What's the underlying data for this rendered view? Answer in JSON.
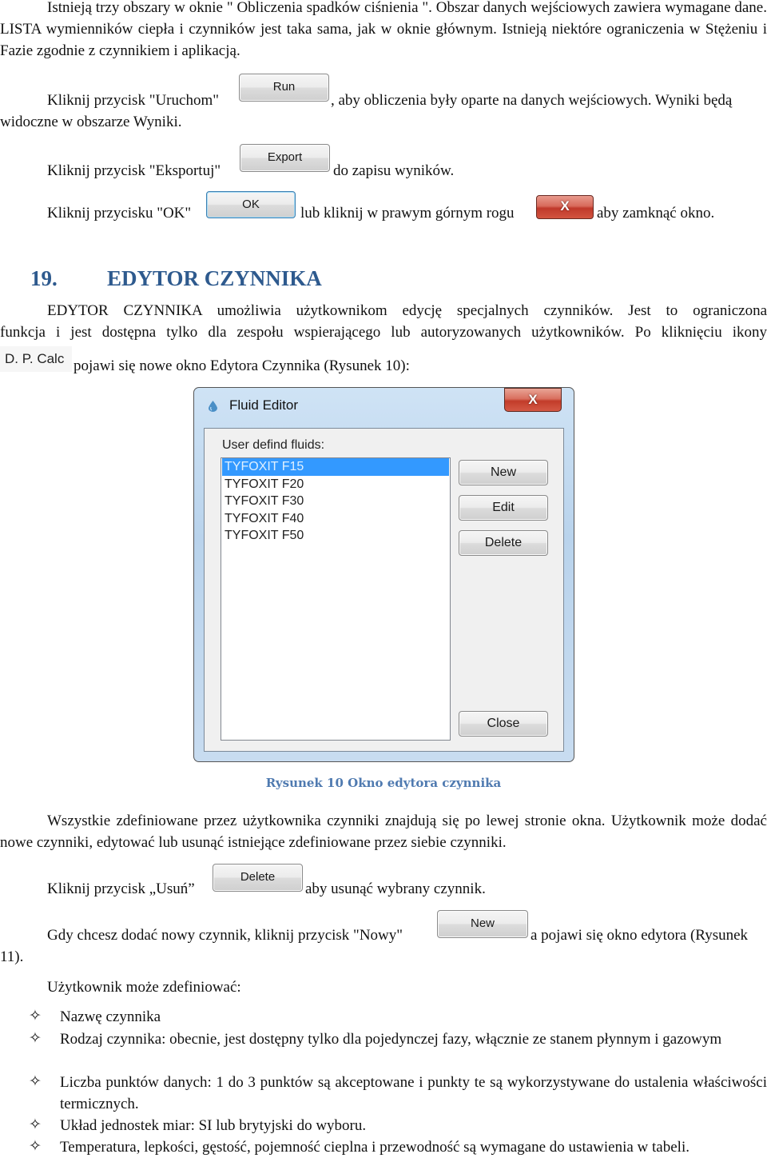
{
  "intro": {
    "paragraph": "Istnieją trzy obszary w oknie \" Obliczenia spadków ciśnienia \". Obszar danych wejściowych zawiera wymagane dane. LISTA wymienników ciepła i czynników jest taka sama, jak w oknie głównym. Istnieją niektóre ograniczenia w Stężeniu i Fazie zgodnie z czynnikiem i aplikacją.",
    "run_before": "Kliknij przycisk \"Uruchom\"",
    "run_button": "Run",
    "run_after": ", aby obliczenia były oparte na danych wejściowych. Wyniki będą",
    "run_line2": "widoczne w obszarze Wyniki.",
    "export_before": "Kliknij przycisk \"Eksportuj\"",
    "export_button": "Export",
    "export_after": "do zapisu wyników.",
    "ok_before": "Kliknij przycisku \"OK\"",
    "ok_button": "OK",
    "ok_middle": "lub kliknij w prawym górnym rogu",
    "close_button": "X",
    "ok_after": "aby zamknąć okno."
  },
  "section": {
    "number": "19.",
    "title": "EDYTOR CZYNNIKA",
    "paragraph_line1": "EDYTOR CZYNNIKA umożliwia użytkownikom edycję specjalnych czynników. Jest to ograniczona",
    "paragraph_line2": "funkcja i jest dostępna tylko dla zespołu wspierającego lub autoryzowanych użytkowników. Po kliknięciu ikony",
    "dpcalc_icon_label": "D. P. Calc",
    "paragraph_line3": "pojawi się nowe okno Edytora Czynnika (Rysunek 10):"
  },
  "fluid_editor": {
    "title": "Fluid Editor",
    "close_glyph": "X",
    "list_label": "User defind fluids:",
    "fluids": [
      "TYFOXIT F15",
      "TYFOXIT F20",
      "TYFOXIT F30",
      "TYFOXIT F40",
      "TYFOXIT F50"
    ],
    "selected_index": 0,
    "buttons": {
      "new": "New",
      "edit": "Edit",
      "delete": "Delete",
      "close": "Close"
    }
  },
  "figure_caption": "Rysunek 10 Okno edytora czynnika",
  "after": {
    "paragraph": "Wszystkie zdefiniowane przez użytkownika czynniki znajdują się po lewej stronie okna. Użytkownik może dodać nowe czynniki, edytować lub usunąć istniejące zdefiniowane przez siebie czynniki.",
    "delete_before": "Kliknij przycisk „Usuń”",
    "delete_button": "Delete",
    "delete_after": "aby usunąć wybrany czynnik.",
    "new_before": "Gdy chcesz dodać nowy czynnik, kliknij przycisk \"Nowy\"",
    "new_button": "New",
    "new_after": "a pojawi się okno edytora (Rysunek",
    "new_line2": "11).",
    "define_intro": "Użytkownik może zdefiniować:",
    "bullet_glyph": "✧",
    "bullets": [
      "Nazwę czynnika",
      "Rodzaj czynnika: obecnie, jest dostępny tylko dla pojedynczej fazy, włącznie ze stanem płynnym i gazowym",
      "Liczba punktów danych: 1 do 3 punktów są akceptowane i punkty te są wykorzystywane do  ustalenia właściwości termicznych.",
      "Układ jednostek miar: SI lub brytyjski do wyboru.",
      "Temperatura, lepkości, gęstość, pojemność cieplna i przewodność są wymagane do ustawienia w tabeli."
    ]
  },
  "colors": {
    "heading": "#2e5a8e",
    "caption": "#4f7ab0",
    "selection": "#3399ff"
  }
}
